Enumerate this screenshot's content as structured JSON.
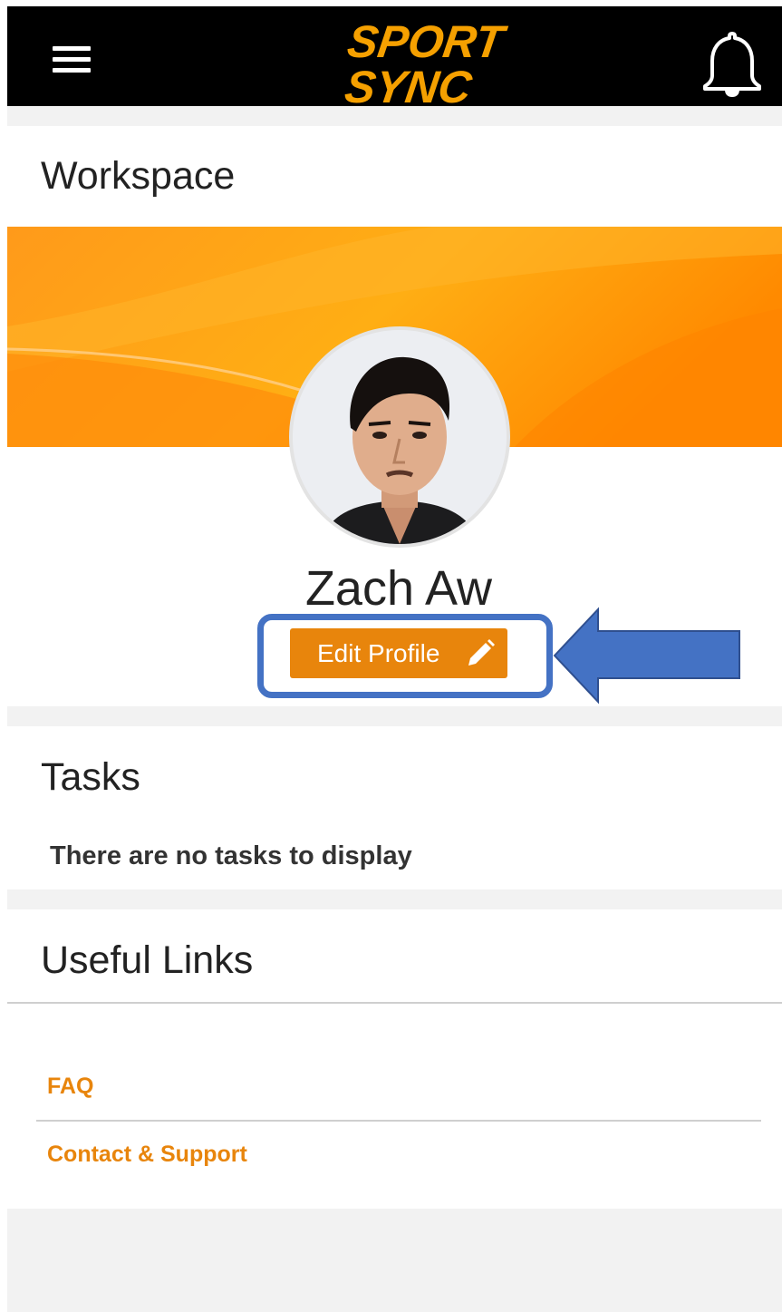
{
  "header": {
    "logo_line1": "SPORT",
    "logo_line2": "SYNC",
    "menu_icon": "hamburger-menu-icon",
    "notification_icon": "bell-icon"
  },
  "workspace": {
    "title": "Workspace",
    "profile_name": "Zach Aw",
    "edit_button_label": "Edit Profile",
    "edit_icon": "pencil-icon"
  },
  "tasks": {
    "title": "Tasks",
    "empty_message": "There are no tasks to display"
  },
  "useful_links": {
    "title": "Useful Links",
    "items": [
      {
        "label": "FAQ"
      },
      {
        "label": "Contact & Support"
      }
    ]
  },
  "colors": {
    "accent": "#e8850c",
    "header_bg": "#000000",
    "annotation_blue": "#4472c4",
    "page_gray": "#f2f2f2"
  }
}
